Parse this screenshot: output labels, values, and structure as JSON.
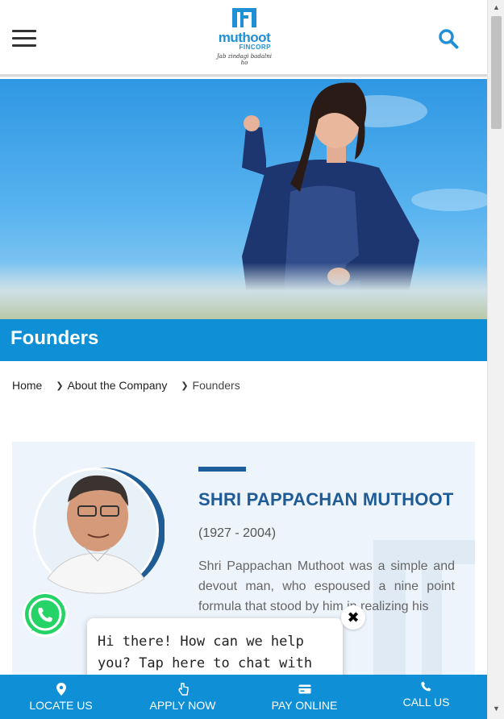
{
  "header": {
    "logo_brand": "muthoot",
    "logo_sub": "FINCORP",
    "logo_tagline": "Jab zindagi badalni ho",
    "menu_icon": "hamburger-icon",
    "search_icon": "search-icon"
  },
  "page": {
    "title": "Founders"
  },
  "breadcrumb": {
    "items": [
      "Home",
      "About the Company",
      "Founders"
    ]
  },
  "founder": {
    "name": "SHRI PAPPACHAN MUTHOOT",
    "years": "(1927 - 2004)",
    "bio": "Shri Pappachan Muthoot was a simple and devout man, who espoused a nine point formula that stood by him in realizing his"
  },
  "chat": {
    "message": "Hi there! How can we help you? Tap here to chat with us.",
    "close_label": "✖"
  },
  "bottom_nav": {
    "items": [
      {
        "label": "LOCATE US",
        "icon": "location-pin-icon"
      },
      {
        "label": "APPLY NOW",
        "icon": "hand-pointer-icon"
      },
      {
        "label": "PAY ONLINE",
        "icon": "credit-card-icon"
      },
      {
        "label": "CALL US",
        "icon": "phone-icon"
      }
    ]
  },
  "colors": {
    "brand_blue": "#0e8fd6",
    "name_blue": "#1f5c96",
    "card_bg": "#edf4fb",
    "whatsapp_green": "#25d366"
  }
}
